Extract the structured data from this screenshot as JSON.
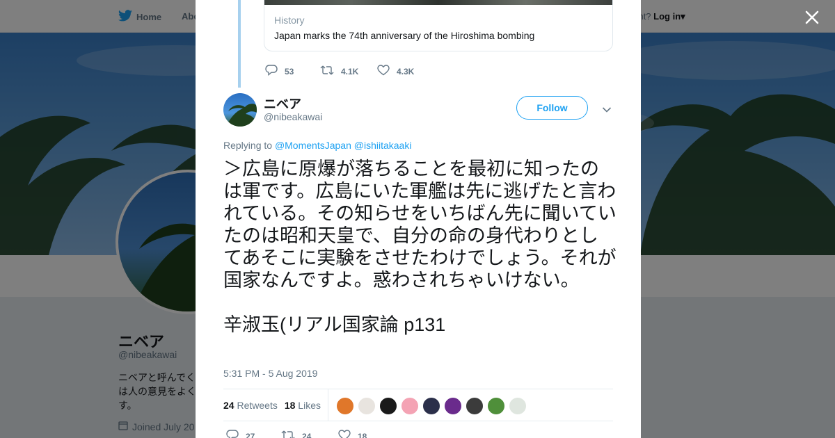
{
  "topnav": {
    "home_label": "Home",
    "about_label": "Abo",
    "account_prompt": "ccount?",
    "login_label": "Log in"
  },
  "profile": {
    "name": "ニベア",
    "handle": "@nibeakawai",
    "bio": "ニベアと呼んでくは人の意見をよくす。",
    "joined": "Joined July 20"
  },
  "quoted_card": {
    "source": "History",
    "title": "Japan marks the 74th anniversary of the Hiroshima bombing"
  },
  "parent_actions": {
    "replies": "53",
    "retweets": "4.1K",
    "likes": "4.3K"
  },
  "tweet": {
    "name": "ニベア",
    "handle": "@nibeakawai",
    "follow_label": "Follow",
    "replying_prefix": "Replying to",
    "replying_to": [
      "@MomentsJapan",
      "@ishiitakaaki"
    ],
    "text_paragraph_1": "＞広島に原爆が落ちることを最初に知ったのは軍です。広島にいた軍艦は先に逃げたと言われている。その知らせをいちばん先に聞いていたのは昭和天皇で、自分の命の身代わりとしてあそこに実験をさせたわけでしょう。それが国家なんですよ。惑わされちゃいけない。",
    "text_paragraph_2": "辛淑玉(リアル国家論 p131",
    "timestamp": "5:31 PM - 5 Aug 2019",
    "retweets_count": "24",
    "retweets_label": "Retweets",
    "likes_count": "18",
    "likes_label": "Likes",
    "liker_avatar_colors": [
      "#e0772a",
      "#e8e4df",
      "#1a1a1a",
      "#f4a3b4",
      "#2b2f4a",
      "#6a2b8c",
      "#3b3b3b",
      "#4f8f3a",
      "#dfe6df"
    ],
    "actions": {
      "replies": "27",
      "retweets": "24",
      "likes": "18"
    }
  },
  "colors": {
    "brand": "#1da1f2",
    "thread_line": "#a6d0ee",
    "secondary_text": "#657786"
  }
}
